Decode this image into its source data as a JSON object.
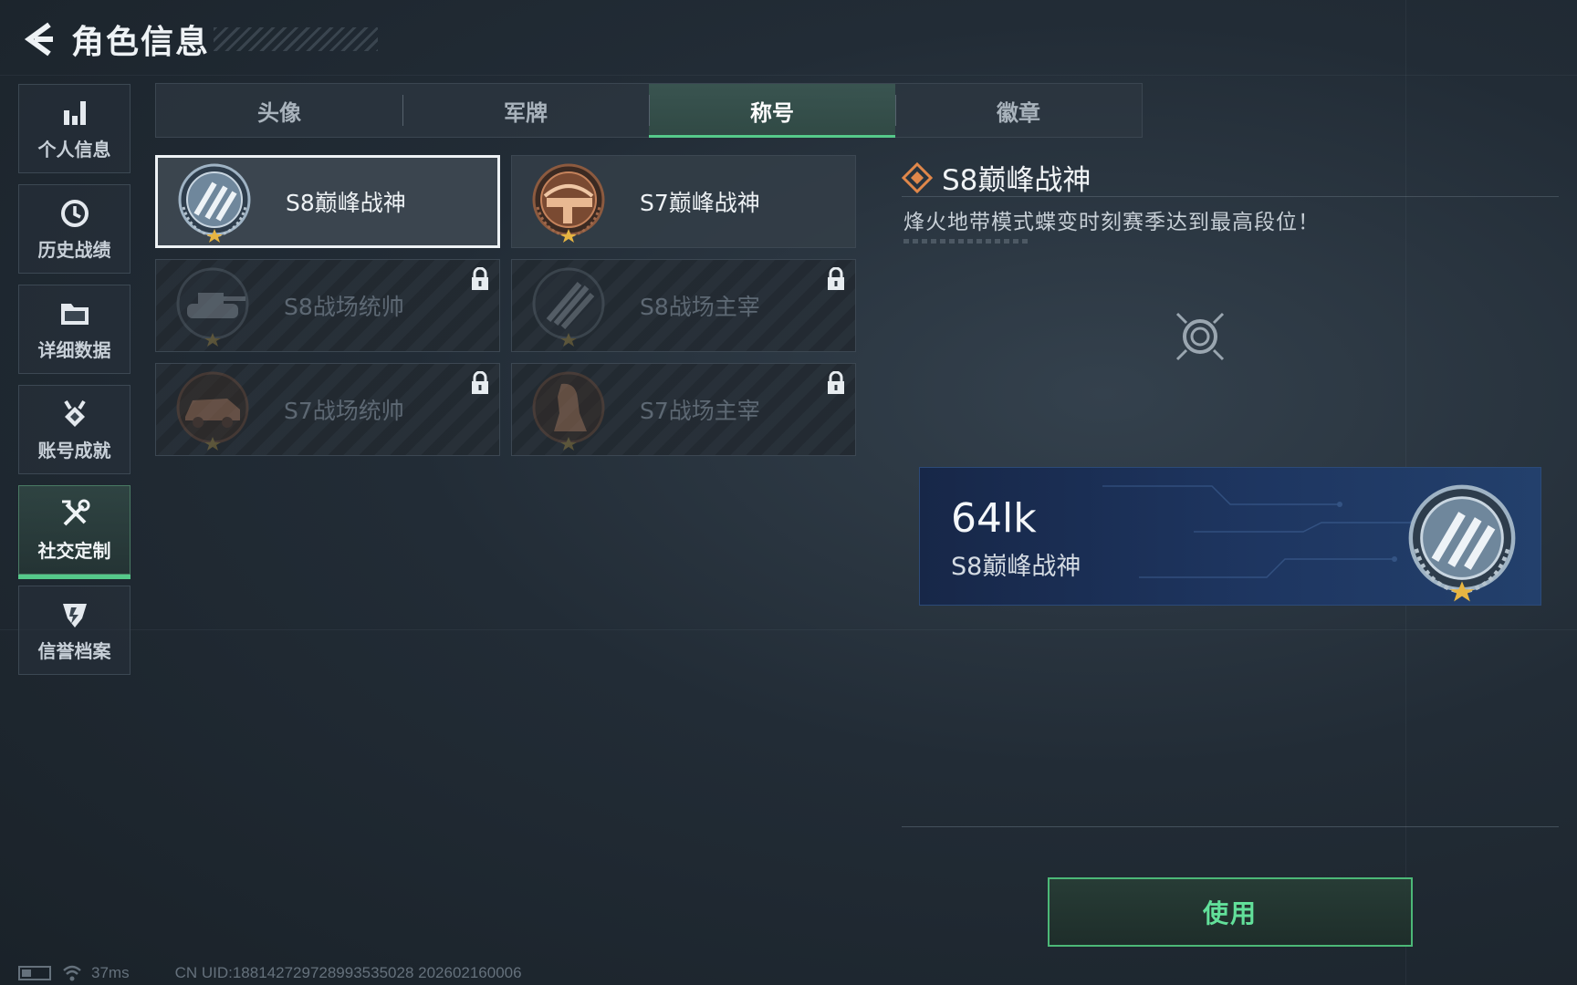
{
  "header": {
    "title": "角色信息"
  },
  "sidebar": {
    "items": [
      {
        "label": "个人信息",
        "icon": "bar-chart-icon"
      },
      {
        "label": "历史战绩",
        "icon": "history-icon"
      },
      {
        "label": "详细数据",
        "icon": "folder-icon"
      },
      {
        "label": "账号成就",
        "icon": "medal-icon"
      },
      {
        "label": "社交定制",
        "icon": "tools-icon",
        "active": true
      },
      {
        "label": "信誉档案",
        "icon": "shield-icon"
      }
    ]
  },
  "tabs": [
    {
      "label": "头像"
    },
    {
      "label": "军牌"
    },
    {
      "label": "称号",
      "active": true
    },
    {
      "label": "徽章"
    }
  ],
  "cards": [
    {
      "name": "S8巅峰战神",
      "locked": false,
      "selected": true,
      "emblem": "silver-wings-emblem"
    },
    {
      "name": "S7巅峰战神",
      "locked": false,
      "selected": false,
      "emblem": "bronze-crossbow-emblem"
    },
    {
      "name": "S8战场统帅",
      "locked": true,
      "selected": false,
      "emblem": "tank-emblem"
    },
    {
      "name": "S8战场主宰",
      "locked": true,
      "selected": false,
      "emblem": "missile-emblem"
    },
    {
      "name": "S7战场统帅",
      "locked": true,
      "selected": false,
      "emblem": "vehicle-emblem"
    },
    {
      "name": "S7战场主宰",
      "locked": true,
      "selected": false,
      "emblem": "soldier-emblem"
    }
  ],
  "detail": {
    "title": "S8巅峰战神",
    "description": "烽火地带模式蝶变时刻赛季达到最高段位！"
  },
  "banner": {
    "player_name": "64lk",
    "title": "S8巅峰战神"
  },
  "actions": {
    "use_label": "使用"
  },
  "footer": {
    "ping": "37ms",
    "uid": "CN UID:188142729728993535028 202602160006"
  },
  "colors": {
    "accent_green": "#55c98a",
    "button_text": "#62e09a",
    "title_icon_orange": "#e0874a",
    "banner_blue": "#1e3661"
  }
}
